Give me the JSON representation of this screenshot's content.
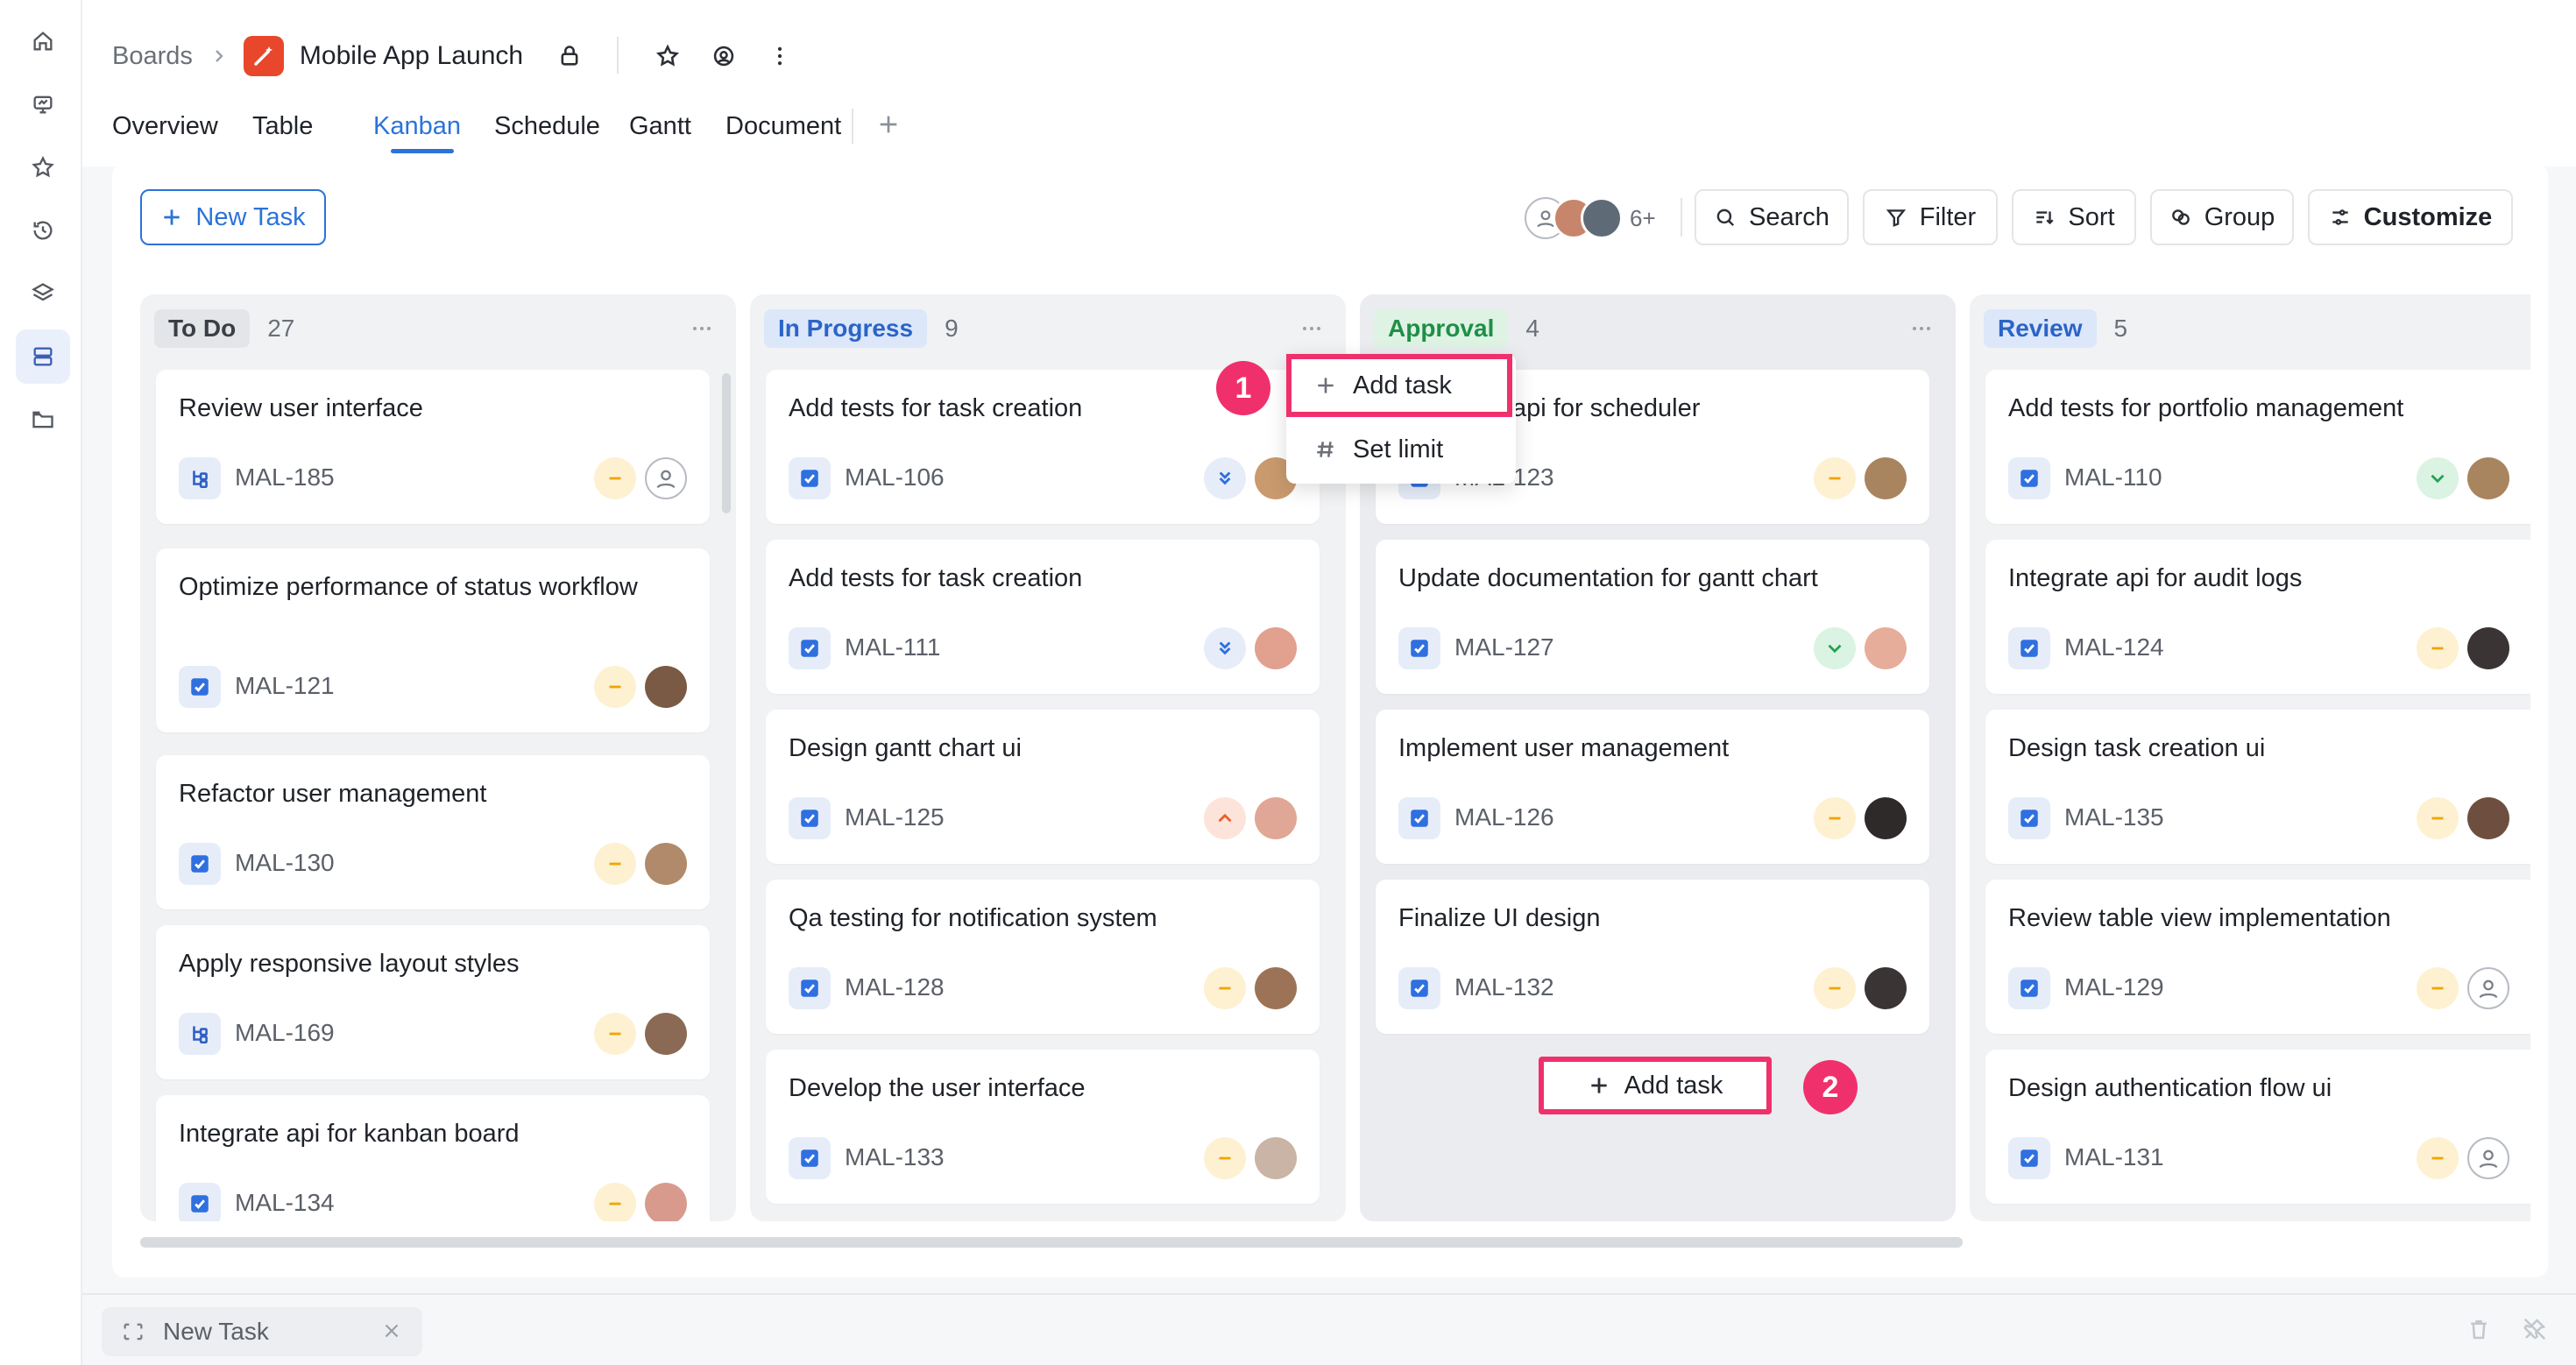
{
  "breadcrumb": {
    "root": "Boards",
    "project": "Mobile App Launch"
  },
  "tabs": [
    "Overview",
    "Table",
    "Kanban",
    "Schedule",
    "Gantt",
    "Document"
  ],
  "active_tab": "Kanban",
  "toolbar": {
    "new_task": "New Task",
    "avatar_more": "6+",
    "search": "Search",
    "filter": "Filter",
    "sort": "Sort",
    "group": "Group",
    "customize": "Customize"
  },
  "columns": [
    {
      "name": "To Do",
      "count": "27",
      "cards": [
        {
          "title": "Review user interface",
          "id": "MAL-185",
          "type": "subtask",
          "priority": "medium",
          "assignee": "unassigned"
        },
        {
          "title": "Optimize performance of status workflow",
          "id": "MAL-121",
          "type": "task",
          "priority": "medium",
          "assignee": "avatar"
        },
        {
          "title": "Refactor user management",
          "id": "MAL-130",
          "type": "task",
          "priority": "medium",
          "assignee": "avatar"
        },
        {
          "title": "Apply responsive layout styles",
          "id": "MAL-169",
          "type": "subtask",
          "priority": "medium",
          "assignee": "avatar"
        },
        {
          "title": "Integrate api for kanban board",
          "id": "MAL-134",
          "type": "task",
          "priority": "medium",
          "assignee": "avatar"
        }
      ]
    },
    {
      "name": "In Progress",
      "count": "9",
      "cards": [
        {
          "title": "Add tests for task creation",
          "id": "MAL-106",
          "type": "task",
          "priority": "lowest",
          "assignee": "avatar"
        },
        {
          "title": "Add tests for task creation",
          "id": "MAL-111",
          "type": "task",
          "priority": "lowest",
          "assignee": "avatar"
        },
        {
          "title": "Design gantt chart ui",
          "id": "MAL-125",
          "type": "task",
          "priority": "high",
          "assignee": "avatar"
        },
        {
          "title": "Qa testing for notification system",
          "id": "MAL-128",
          "type": "task",
          "priority": "medium",
          "assignee": "avatar"
        },
        {
          "title": "Develop the user interface",
          "id": "MAL-133",
          "type": "task",
          "priority": "medium",
          "assignee": "avatar"
        }
      ]
    },
    {
      "name": "Approval",
      "count": "4",
      "cards": [
        {
          "title": "api for scheduler",
          "id": "MAL-123",
          "type": "task",
          "priority": "medium",
          "assignee": "avatar"
        },
        {
          "title": "Update documentation for gantt chart",
          "id": "MAL-127",
          "type": "task",
          "priority": "low",
          "assignee": "avatar"
        },
        {
          "title": "Implement user management",
          "id": "MAL-126",
          "type": "task",
          "priority": "medium",
          "assignee": "avatar"
        },
        {
          "title": "Finalize UI design",
          "id": "MAL-132",
          "type": "task",
          "priority": "medium",
          "assignee": "avatar"
        }
      ],
      "add_task": "Add task"
    },
    {
      "name": "Review",
      "count": "5",
      "cards": [
        {
          "title": "Add tests for portfolio management",
          "id": "MAL-110",
          "type": "task",
          "priority": "low",
          "assignee": "avatar"
        },
        {
          "title": "Integrate api for audit logs",
          "id": "MAL-124",
          "type": "task",
          "priority": "medium",
          "assignee": "avatar"
        },
        {
          "title": "Design task creation ui",
          "id": "MAL-135",
          "type": "task",
          "priority": "medium",
          "assignee": "avatar"
        },
        {
          "title": "Review table view implementation",
          "id": "MAL-129",
          "type": "task",
          "priority": "medium",
          "assignee": "unassigned"
        },
        {
          "title": "Design authentication flow ui",
          "id": "MAL-131",
          "type": "task",
          "priority": "medium",
          "assignee": "unassigned"
        }
      ]
    }
  ],
  "column_menu": {
    "add_task": "Add task",
    "set_limit": "Set limit"
  },
  "annotations": {
    "first": "1",
    "second": "2"
  },
  "bottom_bar": {
    "draft_label": "New Task"
  },
  "colors": {
    "accent": "#2b73d9",
    "highlight": "#f0306c",
    "brand_logo": "#e8472c"
  }
}
